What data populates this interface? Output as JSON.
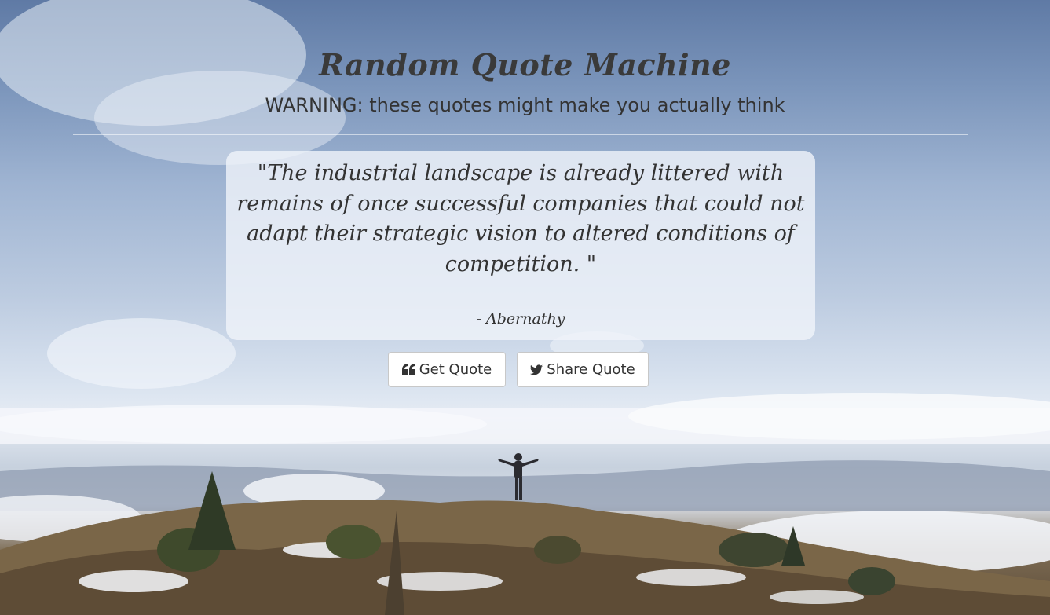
{
  "header": {
    "title": "Random Quote Machine",
    "subtitle": "WARNING: these quotes might make you actually think"
  },
  "quote": {
    "text": "\"The industrial landscape is already littered with remains of once successful companies that could not adapt their strategic vision to altered conditions of competition. \"",
    "author": "- Abernathy"
  },
  "buttons": {
    "get_quote": {
      "label": "Get Quote",
      "icon": "quote-left-icon"
    },
    "share_quote": {
      "label": "Share Quote",
      "icon": "twitter-icon"
    }
  },
  "background": {
    "scene": "mountain-summit-photo",
    "colors": {
      "sky": "#7b95bb",
      "clouds": "#e6ecf4",
      "ground": "#6b5a42"
    }
  }
}
